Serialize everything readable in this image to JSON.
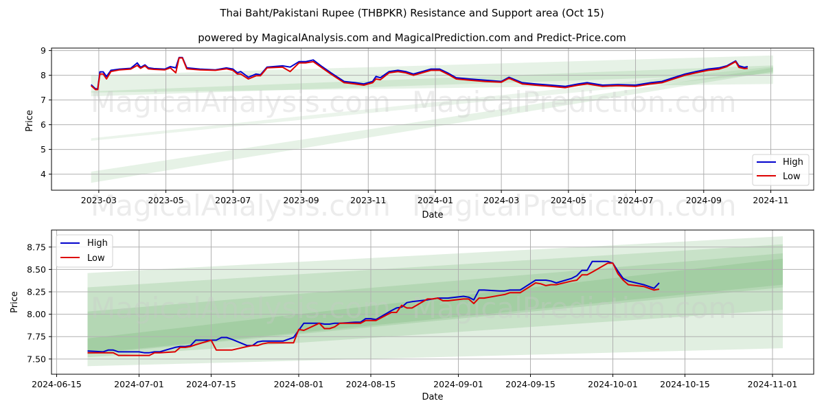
{
  "header": {
    "title": "Thai Baht/Pakistani Rupee (THBPKR) Resistance and Support area (Oct 15)",
    "subtitle": "powered by MagicalAnalysis.com and MagicalPrediction.com and Predict-Price.com"
  },
  "watermarks": [
    "MagicalAnalysis.com",
    "MagicalPrediction.com"
  ],
  "colors": {
    "high": "#0000cc",
    "low": "#dd0000",
    "band": "#5aa85a",
    "grid": "#b0b0b0"
  },
  "chart_data": [
    {
      "type": "line",
      "title": "",
      "xlabel": "Date",
      "ylabel": "Price",
      "xlim": [
        "2023-01-17",
        "2024-12-10"
      ],
      "ylim": [
        3.35,
        9.1
      ],
      "grid": true,
      "legend_position": "bottom-right",
      "x_ticks": [
        "2023-03",
        "2023-05",
        "2023-07",
        "2023-09",
        "2023-11",
        "2024-01",
        "2024-03",
        "2024-05",
        "2024-07",
        "2024-09",
        "2024-11"
      ],
      "y_ticks": [
        4,
        5,
        6,
        7,
        8,
        9
      ],
      "legend": [
        "High",
        "Low"
      ],
      "bands": [
        {
          "x": [
            "2023-02-22",
            "2024-11-03"
          ],
          "lower": [
            7.3,
            7.65
          ],
          "upper": [
            8.0,
            8.8
          ],
          "opacity": 0.15
        },
        {
          "x": [
            "2023-02-22",
            "2024-11-03"
          ],
          "lower": [
            7.15,
            8.05
          ],
          "upper": [
            7.35,
            8.4
          ],
          "opacity": 0.15
        },
        {
          "x": [
            "2023-02-22",
            "2024-11-03"
          ],
          "lower": [
            5.35,
            8.1
          ],
          "upper": [
            5.45,
            8.35
          ],
          "opacity": 0.12
        },
        {
          "x": [
            "2023-02-22",
            "2024-11-03"
          ],
          "lower": [
            3.65,
            8.15
          ],
          "upper": [
            4.1,
            8.3
          ],
          "opacity": 0.15
        }
      ],
      "series": [
        {
          "name": "High",
          "x": [
            "2023-02-22",
            "2023-02-26",
            "2023-02-28",
            "2023-03-02",
            "2023-03-05",
            "2023-03-08",
            "2023-03-12",
            "2023-03-20",
            "2023-03-30",
            "2023-04-05",
            "2023-04-08",
            "2023-04-12",
            "2023-04-15",
            "2023-04-20",
            "2023-04-30",
            "2023-05-05",
            "2023-05-10",
            "2023-05-13",
            "2023-05-16",
            "2023-05-20",
            "2023-06-01",
            "2023-06-15",
            "2023-06-25",
            "2023-07-01",
            "2023-07-05",
            "2023-07-08",
            "2023-07-15",
            "2023-07-22",
            "2023-07-26",
            "2023-08-01",
            "2023-08-15",
            "2023-08-22",
            "2023-08-30",
            "2023-09-05",
            "2023-09-12",
            "2023-09-20",
            "2023-09-28",
            "2023-10-10",
            "2023-10-20",
            "2023-10-28",
            "2023-11-05",
            "2023-11-08",
            "2023-11-12",
            "2023-11-20",
            "2023-11-28",
            "2023-12-05",
            "2023-12-12",
            "2023-12-20",
            "2023-12-28",
            "2024-01-05",
            "2024-01-12",
            "2024-01-20",
            "2024-02-01",
            "2024-02-15",
            "2024-03-01",
            "2024-03-08",
            "2024-03-20",
            "2024-04-01",
            "2024-04-15",
            "2024-04-28",
            "2024-05-10",
            "2024-05-18",
            "2024-06-01",
            "2024-06-15",
            "2024-07-01",
            "2024-07-15",
            "2024-07-25",
            "2024-08-01",
            "2024-08-15",
            "2024-08-25",
            "2024-09-05",
            "2024-09-15",
            "2024-09-22",
            "2024-09-30",
            "2024-10-03",
            "2024-10-08",
            "2024-10-11"
          ],
          "values": [
            7.62,
            7.45,
            7.45,
            8.14,
            8.14,
            7.95,
            8.2,
            8.25,
            8.28,
            8.5,
            8.32,
            8.42,
            8.3,
            8.27,
            8.25,
            8.35,
            8.3,
            8.72,
            8.72,
            8.3,
            8.25,
            8.22,
            8.3,
            8.25,
            8.1,
            8.15,
            7.92,
            8.05,
            8.02,
            8.33,
            8.38,
            8.33,
            8.55,
            8.55,
            8.62,
            8.35,
            8.1,
            7.75,
            7.7,
            7.65,
            7.75,
            7.95,
            7.9,
            8.15,
            8.2,
            8.15,
            8.05,
            8.15,
            8.25,
            8.25,
            8.1,
            7.9,
            7.85,
            7.8,
            7.75,
            7.92,
            7.7,
            7.65,
            7.6,
            7.55,
            7.65,
            7.7,
            7.6,
            7.62,
            7.6,
            7.7,
            7.75,
            7.85,
            8.05,
            8.15,
            8.25,
            8.3,
            8.38,
            8.58,
            8.38,
            8.32,
            8.35
          ]
        },
        {
          "name": "Low",
          "x": [
            "2023-02-22",
            "2023-02-26",
            "2023-02-28",
            "2023-03-02",
            "2023-03-05",
            "2023-03-08",
            "2023-03-12",
            "2023-03-20",
            "2023-03-30",
            "2023-04-05",
            "2023-04-08",
            "2023-04-12",
            "2023-04-15",
            "2023-04-20",
            "2023-04-30",
            "2023-05-05",
            "2023-05-10",
            "2023-05-13",
            "2023-05-16",
            "2023-05-20",
            "2023-06-01",
            "2023-06-15",
            "2023-06-25",
            "2023-07-01",
            "2023-07-05",
            "2023-07-08",
            "2023-07-15",
            "2023-07-22",
            "2023-07-26",
            "2023-08-01",
            "2023-08-15",
            "2023-08-22",
            "2023-08-30",
            "2023-09-05",
            "2023-09-12",
            "2023-09-20",
            "2023-09-28",
            "2023-10-10",
            "2023-10-20",
            "2023-10-28",
            "2023-11-05",
            "2023-11-08",
            "2023-11-12",
            "2023-11-20",
            "2023-11-28",
            "2023-12-05",
            "2023-12-12",
            "2023-12-20",
            "2023-12-28",
            "2024-01-05",
            "2024-01-12",
            "2024-01-20",
            "2024-02-01",
            "2024-02-15",
            "2024-03-01",
            "2024-03-08",
            "2024-03-20",
            "2024-04-01",
            "2024-04-15",
            "2024-04-28",
            "2024-05-10",
            "2024-05-18",
            "2024-06-01",
            "2024-06-15",
            "2024-07-01",
            "2024-07-15",
            "2024-07-25",
            "2024-08-01",
            "2024-08-15",
            "2024-08-25",
            "2024-09-05",
            "2024-09-15",
            "2024-09-22",
            "2024-09-30",
            "2024-10-03",
            "2024-10-08",
            "2024-10-11"
          ],
          "values": [
            7.58,
            7.42,
            7.42,
            8.05,
            8.05,
            7.85,
            8.15,
            8.22,
            8.25,
            8.4,
            8.28,
            8.38,
            8.26,
            8.24,
            8.22,
            8.3,
            8.1,
            8.7,
            8.7,
            8.26,
            8.22,
            8.2,
            8.26,
            8.2,
            8.05,
            8.05,
            7.85,
            7.98,
            7.98,
            8.3,
            8.33,
            8.15,
            8.5,
            8.5,
            8.55,
            8.3,
            8.05,
            7.7,
            7.65,
            7.6,
            7.7,
            7.85,
            7.82,
            8.1,
            8.15,
            8.1,
            8.0,
            8.1,
            8.2,
            8.2,
            8.05,
            7.85,
            7.8,
            7.75,
            7.72,
            7.88,
            7.65,
            7.6,
            7.55,
            7.5,
            7.6,
            7.65,
            7.55,
            7.58,
            7.55,
            7.65,
            7.7,
            7.8,
            8.0,
            8.1,
            8.2,
            8.25,
            8.35,
            8.55,
            8.32,
            8.27,
            8.28
          ]
        }
      ]
    },
    {
      "type": "line",
      "title": "",
      "xlabel": "Date",
      "ylabel": "Price",
      "xlim": [
        "2024-06-14",
        "2024-11-09"
      ],
      "ylim": [
        7.33,
        8.94
      ],
      "grid": true,
      "legend_position": "top-left",
      "x_ticks": [
        "2024-06-15",
        "2024-07-01",
        "2024-07-15",
        "2024-08-01",
        "2024-08-15",
        "2024-09-01",
        "2024-09-15",
        "2024-10-01",
        "2024-10-15",
        "2024-11-01"
      ],
      "y_ticks": [
        "7.50",
        "7.75",
        "8.00",
        "8.25",
        "8.50",
        "8.75"
      ],
      "legend": [
        "High",
        "Low"
      ],
      "bands": [
        {
          "x": [
            "2024-06-21",
            "2024-11-03"
          ],
          "lower": [
            7.42,
            7.62
          ],
          "upper": [
            8.46,
            8.87
          ],
          "opacity": 0.18
        },
        {
          "x": [
            "2024-06-21",
            "2024-11-03"
          ],
          "lower": [
            7.52,
            8.05
          ],
          "upper": [
            8.3,
            8.78
          ],
          "opacity": 0.18
        },
        {
          "x": [
            "2024-06-21",
            "2024-11-03"
          ],
          "lower": [
            7.55,
            8.3
          ],
          "upper": [
            8.03,
            8.68
          ],
          "opacity": 0.18
        },
        {
          "x": [
            "2024-06-21",
            "2024-11-03"
          ],
          "lower": [
            7.56,
            8.33
          ],
          "upper": [
            7.73,
            8.62
          ],
          "opacity": 0.18
        }
      ],
      "series": [
        {
          "name": "High",
          "x": [
            "2024-06-21",
            "2024-06-24",
            "2024-06-25",
            "2024-06-26",
            "2024-06-27",
            "2024-06-28",
            "2024-07-01",
            "2024-07-02",
            "2024-07-03",
            "2024-07-04",
            "2024-07-05",
            "2024-07-08",
            "2024-07-09",
            "2024-07-10",
            "2024-07-11",
            "2024-07-12",
            "2024-07-15",
            "2024-07-16",
            "2024-07-17",
            "2024-07-18",
            "2024-07-19",
            "2024-07-22",
            "2024-07-23",
            "2024-07-24",
            "2024-07-25",
            "2024-07-26",
            "2024-07-29",
            "2024-07-30",
            "2024-07-31",
            "2024-08-01",
            "2024-08-02",
            "2024-08-05",
            "2024-08-06",
            "2024-08-07",
            "2024-08-08",
            "2024-08-09",
            "2024-08-12",
            "2024-08-13",
            "2024-08-14",
            "2024-08-15",
            "2024-08-16",
            "2024-08-19",
            "2024-08-20",
            "2024-08-21",
            "2024-08-22",
            "2024-08-23",
            "2024-08-26",
            "2024-08-27",
            "2024-08-28",
            "2024-08-29",
            "2024-08-30",
            "2024-09-02",
            "2024-09-03",
            "2024-09-04",
            "2024-09-05",
            "2024-09-06",
            "2024-09-09",
            "2024-09-10",
            "2024-09-11",
            "2024-09-12",
            "2024-09-13",
            "2024-09-16",
            "2024-09-17",
            "2024-09-18",
            "2024-09-19",
            "2024-09-20",
            "2024-09-23",
            "2024-09-24",
            "2024-09-25",
            "2024-09-26",
            "2024-09-27",
            "2024-09-30",
            "2024-10-01",
            "2024-10-02",
            "2024-10-03",
            "2024-10-04",
            "2024-10-07",
            "2024-10-08",
            "2024-10-09",
            "2024-10-10"
          ],
          "values": [
            7.59,
            7.58,
            7.6,
            7.6,
            7.58,
            7.58,
            7.58,
            7.57,
            7.57,
            7.58,
            7.58,
            7.63,
            7.64,
            7.64,
            7.65,
            7.71,
            7.71,
            7.71,
            7.74,
            7.74,
            7.72,
            7.65,
            7.65,
            7.69,
            7.7,
            7.7,
            7.7,
            7.72,
            7.74,
            7.82,
            7.9,
            7.9,
            7.89,
            7.89,
            7.9,
            7.9,
            7.91,
            7.91,
            7.95,
            7.95,
            7.94,
            8.04,
            8.07,
            8.08,
            8.13,
            8.14,
            8.16,
            8.17,
            8.18,
            8.18,
            8.18,
            8.2,
            8.19,
            8.16,
            8.27,
            8.27,
            8.26,
            8.26,
            8.27,
            8.27,
            8.27,
            8.38,
            8.38,
            8.38,
            8.37,
            8.35,
            8.4,
            8.43,
            8.49,
            8.49,
            8.59,
            8.59,
            8.57,
            8.48,
            8.4,
            8.37,
            8.33,
            8.31,
            8.29,
            8.35
          ]
        },
        {
          "name": "Low",
          "x": [
            "2024-06-21",
            "2024-06-24",
            "2024-06-25",
            "2024-06-26",
            "2024-06-27",
            "2024-06-28",
            "2024-07-01",
            "2024-07-02",
            "2024-07-03",
            "2024-07-04",
            "2024-07-05",
            "2024-07-08",
            "2024-07-09",
            "2024-07-10",
            "2024-07-11",
            "2024-07-12",
            "2024-07-15",
            "2024-07-16",
            "2024-07-17",
            "2024-07-18",
            "2024-07-19",
            "2024-07-22",
            "2024-07-23",
            "2024-07-24",
            "2024-07-25",
            "2024-07-26",
            "2024-07-29",
            "2024-07-30",
            "2024-07-31",
            "2024-08-01",
            "2024-08-02",
            "2024-08-05",
            "2024-08-06",
            "2024-08-07",
            "2024-08-08",
            "2024-08-09",
            "2024-08-12",
            "2024-08-13",
            "2024-08-14",
            "2024-08-15",
            "2024-08-16",
            "2024-08-19",
            "2024-08-20",
            "2024-08-21",
            "2024-08-22",
            "2024-08-23",
            "2024-08-26",
            "2024-08-27",
            "2024-08-28",
            "2024-08-29",
            "2024-08-30",
            "2024-09-02",
            "2024-09-03",
            "2024-09-04",
            "2024-09-05",
            "2024-09-06",
            "2024-09-09",
            "2024-09-10",
            "2024-09-11",
            "2024-09-12",
            "2024-09-13",
            "2024-09-16",
            "2024-09-17",
            "2024-09-18",
            "2024-09-19",
            "2024-09-20",
            "2024-09-23",
            "2024-09-24",
            "2024-09-25",
            "2024-09-26",
            "2024-09-27",
            "2024-09-30",
            "2024-10-01",
            "2024-10-02",
            "2024-10-03",
            "2024-10-04",
            "2024-10-07",
            "2024-10-08",
            "2024-10-09",
            "2024-10-10"
          ],
          "values": [
            7.57,
            7.57,
            7.57,
            7.57,
            7.54,
            7.54,
            7.54,
            7.54,
            7.54,
            7.57,
            7.57,
            7.58,
            7.63,
            7.63,
            7.64,
            7.66,
            7.71,
            7.6,
            7.6,
            7.6,
            7.6,
            7.64,
            7.65,
            7.65,
            7.67,
            7.68,
            7.68,
            7.68,
            7.68,
            7.83,
            7.82,
            7.9,
            7.84,
            7.84,
            7.86,
            7.9,
            7.9,
            7.9,
            7.93,
            7.93,
            7.93,
            8.02,
            8.02,
            8.1,
            8.07,
            8.07,
            8.17,
            8.17,
            8.18,
            8.15,
            8.15,
            8.17,
            8.17,
            8.12,
            8.18,
            8.18,
            8.21,
            8.22,
            8.24,
            8.24,
            8.24,
            8.35,
            8.34,
            8.32,
            8.33,
            8.33,
            8.37,
            8.38,
            8.44,
            8.44,
            8.47,
            8.57,
            8.57,
            8.45,
            8.38,
            8.33,
            8.31,
            8.29,
            8.27,
            8.28
          ]
        }
      ]
    }
  ]
}
